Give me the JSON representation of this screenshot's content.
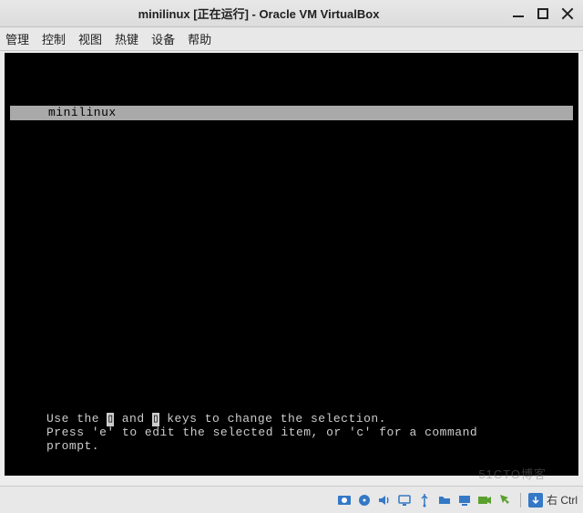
{
  "window": {
    "title": "minilinux [正在运行] - Oracle VM VirtualBox"
  },
  "menu": {
    "items": [
      "管理",
      "控制",
      "视图",
      "热键",
      "设备",
      "帮助"
    ]
  },
  "grub": {
    "entry": "minilinux",
    "hint_line1_a": "Use the ",
    "hint_line1_b": " and ",
    "hint_line1_c": " keys to change the selection.",
    "hint_line2": "Press 'e' to edit the selected item, or 'c' for a command",
    "hint_line3": "prompt."
  },
  "status": {
    "hostkey": "右 Ctrl"
  },
  "watermark": "51CTO博客",
  "colors": {
    "icon_blue": "#3478c6",
    "icon_green": "#5aa02c"
  }
}
